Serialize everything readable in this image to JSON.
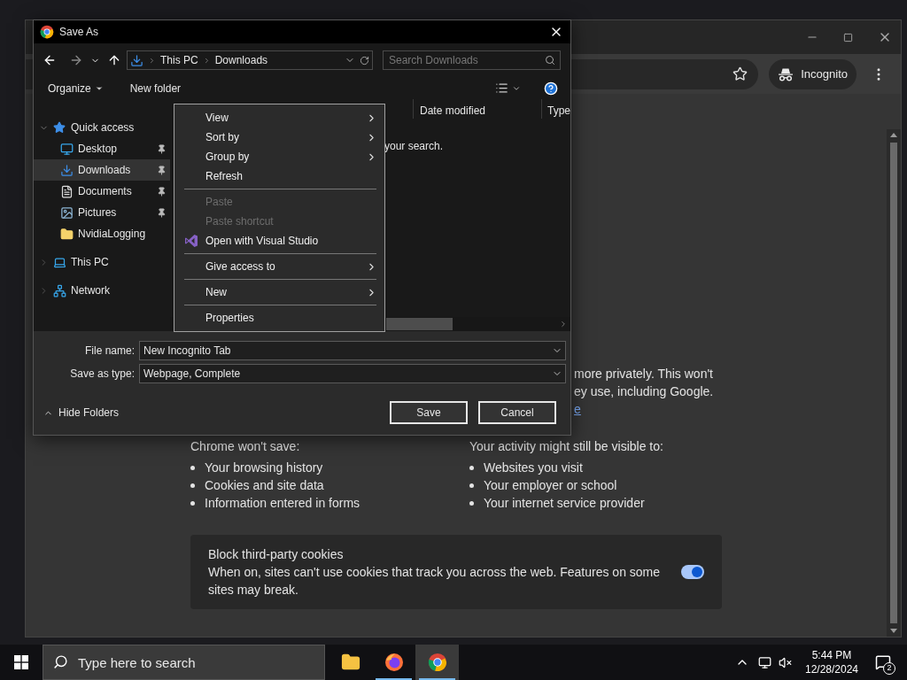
{
  "browser": {
    "incognito_chip": "Incognito",
    "intro_lines": [
      "more privately. This won't",
      "ey use, including Google."
    ],
    "intro_link": "e",
    "columns": [
      {
        "heading": "Chrome won't save:",
        "items": [
          "Your browsing history",
          "Cookies and site data",
          "Information entered in forms"
        ]
      },
      {
        "heading": "Your activity might still be visible to:",
        "items": [
          "Websites you visit",
          "Your employer or school",
          "Your internet service provider"
        ]
      }
    ],
    "cookie_card": {
      "title": "Block third-party cookies",
      "description": "When on, sites can't use cookies that track you across the web. Features on some sites may break.",
      "on": true
    }
  },
  "dialog": {
    "title": "Save As",
    "breadcrumb": [
      "This PC",
      "Downloads"
    ],
    "search": {
      "placeholder": "Search Downloads"
    },
    "commands": [
      {
        "label": "Organize",
        "dropdown": true
      },
      {
        "label": "New folder",
        "dropdown": false
      }
    ],
    "nav_tree": [
      {
        "label": "Quick access",
        "expanded": true,
        "selected": false,
        "pinned": false,
        "children": [
          {
            "label": "Desktop",
            "selected": false,
            "pinned": true
          },
          {
            "label": "Downloads",
            "selected": true,
            "pinned": true
          },
          {
            "label": "Documents",
            "selected": false,
            "pinned": true
          },
          {
            "label": "Pictures",
            "selected": false,
            "pinned": true
          },
          {
            "label": "NvidiaLogging",
            "selected": false,
            "pinned": false
          }
        ]
      },
      {
        "label": "This PC",
        "expanded": false,
        "selected": false,
        "pinned": false
      },
      {
        "label": "Network",
        "expanded": false,
        "selected": false,
        "pinned": false
      }
    ],
    "list_columns": [
      "Date modified",
      "Type"
    ],
    "empty_message": "your search.",
    "file_name_label": "File name:",
    "file_name": "New Incognito Tab",
    "type_label": "Save as type:",
    "save_type": "Webpage, Complete",
    "hide_folders": "Hide Folders",
    "buttons": [
      "Save",
      "Cancel"
    ]
  },
  "context_menu": {
    "items": [
      {
        "label": "View",
        "disabled": false,
        "submenu": true,
        "separator_before": false,
        "icon": false
      },
      {
        "label": "Sort by",
        "disabled": false,
        "submenu": true,
        "separator_before": false,
        "icon": false
      },
      {
        "label": "Group by",
        "disabled": false,
        "submenu": true,
        "separator_before": false,
        "icon": false
      },
      {
        "label": "Refresh",
        "disabled": false,
        "submenu": false,
        "separator_before": false,
        "icon": false
      },
      {
        "label": "Paste",
        "disabled": true,
        "submenu": false,
        "separator_before": true,
        "icon": false
      },
      {
        "label": "Paste shortcut",
        "disabled": true,
        "submenu": false,
        "separator_before": false,
        "icon": false
      },
      {
        "label": "Open with Visual Studio",
        "disabled": false,
        "submenu": false,
        "separator_before": false,
        "icon": true
      },
      {
        "label": "Give access to",
        "disabled": false,
        "submenu": true,
        "separator_before": true,
        "icon": false
      },
      {
        "label": "New",
        "disabled": false,
        "submenu": true,
        "separator_before": true,
        "icon": false
      },
      {
        "label": "Properties",
        "disabled": false,
        "submenu": false,
        "separator_before": true,
        "icon": false
      }
    ]
  },
  "taskbar": {
    "search_placeholder": "Type here to search",
    "apps": [
      {
        "running": false,
        "selected": false
      },
      {
        "running": true,
        "selected": false
      },
      {
        "running": true,
        "selected": true
      }
    ],
    "time": "5:44 PM",
    "date": "12/28/2024",
    "notification_count": "2"
  }
}
